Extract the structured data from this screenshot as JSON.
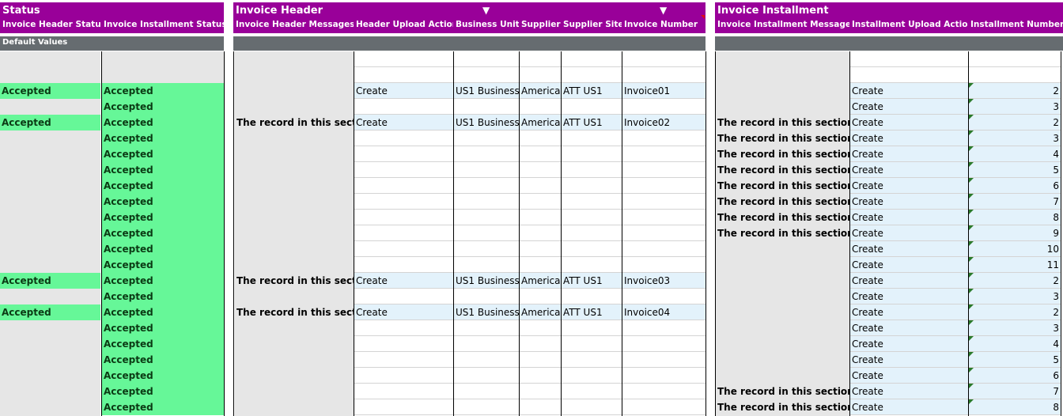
{
  "sections": {
    "status": {
      "title": "Status",
      "headers": [
        "Invoice Header Status",
        "Invoice Installment Status"
      ]
    },
    "invoice_header": {
      "title": "Invoice Header",
      "headers": [
        "Invoice Header Messages",
        "Header Upload Action",
        "Business Unit",
        "Supplier",
        "Supplier Site",
        "Invoice Number"
      ]
    },
    "invoice_installment": {
      "title": "Invoice Installment",
      "headers": [
        "Invoice Installment Messages",
        "Installment Upload Action",
        "Installment Number"
      ]
    }
  },
  "default_values_label": "Default Values",
  "icons": {
    "dropdown": "▼"
  },
  "rows": [
    {
      "hs": "Accepted",
      "is": "Accepted",
      "hm": "",
      "ua": "Create",
      "bu": "US1 Business",
      "sup": "America",
      "site": "ATT US1",
      "inv": "Invoice01",
      "im": "",
      "iua": "Create",
      "num": "2"
    },
    {
      "hs": "",
      "is": "Accepted",
      "hm": "",
      "ua": "",
      "bu": "",
      "sup": "",
      "site": "",
      "inv": "",
      "im": "",
      "iua": "Create",
      "num": "3"
    },
    {
      "hs": "Accepted",
      "is": "Accepted",
      "hm": "The record in this section",
      "ua": "Create",
      "bu": "US1 Business",
      "sup": "America",
      "site": "ATT US1",
      "inv": "Invoice02",
      "im": "The record in this section h",
      "iua": "Create",
      "num": "2"
    },
    {
      "hs": "",
      "is": "Accepted",
      "hm": "",
      "ua": "",
      "bu": "",
      "sup": "",
      "site": "",
      "inv": "",
      "im": "The record in this section h",
      "iua": "Create",
      "num": "3"
    },
    {
      "hs": "",
      "is": "Accepted",
      "hm": "",
      "ua": "",
      "bu": "",
      "sup": "",
      "site": "",
      "inv": "",
      "im": "The record in this section h",
      "iua": "Create",
      "num": "4"
    },
    {
      "hs": "",
      "is": "Accepted",
      "hm": "",
      "ua": "",
      "bu": "",
      "sup": "",
      "site": "",
      "inv": "",
      "im": "The record in this section h",
      "iua": "Create",
      "num": "5"
    },
    {
      "hs": "",
      "is": "Accepted",
      "hm": "",
      "ua": "",
      "bu": "",
      "sup": "",
      "site": "",
      "inv": "",
      "im": "The record in this section h",
      "iua": "Create",
      "num": "6"
    },
    {
      "hs": "",
      "is": "Accepted",
      "hm": "",
      "ua": "",
      "bu": "",
      "sup": "",
      "site": "",
      "inv": "",
      "im": "The record in this section h",
      "iua": "Create",
      "num": "7"
    },
    {
      "hs": "",
      "is": "Accepted",
      "hm": "",
      "ua": "",
      "bu": "",
      "sup": "",
      "site": "",
      "inv": "",
      "im": "The record in this section h",
      "iua": "Create",
      "num": "8"
    },
    {
      "hs": "",
      "is": "Accepted",
      "hm": "",
      "ua": "",
      "bu": "",
      "sup": "",
      "site": "",
      "inv": "",
      "im": "The record in this section h",
      "iua": "Create",
      "num": "9"
    },
    {
      "hs": "",
      "is": "Accepted",
      "hm": "",
      "ua": "",
      "bu": "",
      "sup": "",
      "site": "",
      "inv": "",
      "im": "",
      "iua": "Create",
      "num": "10"
    },
    {
      "hs": "",
      "is": "Accepted",
      "hm": "",
      "ua": "",
      "bu": "",
      "sup": "",
      "site": "",
      "inv": "",
      "im": "",
      "iua": "Create",
      "num": "11"
    },
    {
      "hs": "Accepted",
      "is": "Accepted",
      "hm": "The record in this section",
      "ua": "Create",
      "bu": "US1 Business",
      "sup": "America",
      "site": "ATT US1",
      "inv": "Invoice03",
      "im": "",
      "iua": "Create",
      "num": "2"
    },
    {
      "hs": "",
      "is": "Accepted",
      "hm": "",
      "ua": "",
      "bu": "",
      "sup": "",
      "site": "",
      "inv": "",
      "im": "",
      "iua": "Create",
      "num": "3"
    },
    {
      "hs": "Accepted",
      "is": "Accepted",
      "hm": "The record in this section",
      "ua": "Create",
      "bu": "US1 Business",
      "sup": "America",
      "site": "ATT US1",
      "inv": "Invoice04",
      "im": "",
      "iua": "Create",
      "num": "2"
    },
    {
      "hs": "",
      "is": "Accepted",
      "hm": "",
      "ua": "",
      "bu": "",
      "sup": "",
      "site": "",
      "inv": "",
      "im": "",
      "iua": "Create",
      "num": "3"
    },
    {
      "hs": "",
      "is": "Accepted",
      "hm": "",
      "ua": "",
      "bu": "",
      "sup": "",
      "site": "",
      "inv": "",
      "im": "",
      "iua": "Create",
      "num": "4"
    },
    {
      "hs": "",
      "is": "Accepted",
      "hm": "",
      "ua": "",
      "bu": "",
      "sup": "",
      "site": "",
      "inv": "",
      "im": "",
      "iua": "Create",
      "num": "5"
    },
    {
      "hs": "",
      "is": "Accepted",
      "hm": "",
      "ua": "",
      "bu": "",
      "sup": "",
      "site": "",
      "inv": "",
      "im": "",
      "iua": "Create",
      "num": "6"
    },
    {
      "hs": "",
      "is": "Accepted",
      "hm": "",
      "ua": "",
      "bu": "",
      "sup": "",
      "site": "",
      "inv": "",
      "im": "The record in this section h",
      "iua": "Create",
      "num": "7"
    },
    {
      "hs": "",
      "is": "Accepted",
      "hm": "",
      "ua": "",
      "bu": "",
      "sup": "",
      "site": "",
      "inv": "",
      "im": "The record in this section h",
      "iua": "Create",
      "num": "8"
    }
  ]
}
